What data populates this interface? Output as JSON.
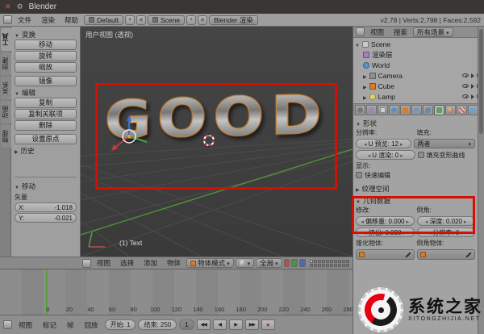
{
  "colors": {
    "annotation_red": "#d40f04",
    "selection_orange": "#e08a2e",
    "frame_line_green": "#55a03a",
    "watermark_red": "#e60012"
  },
  "window": {
    "title": "Blender"
  },
  "info_bar": {
    "menus": [
      "文件",
      "渲染",
      "帮助"
    ],
    "screen": "Default",
    "scene": "Scene",
    "engine": "Blender 渲染",
    "stats": "v2.78 | Verts:2,798 | Faces:2,592"
  },
  "tool_tabs": [
    "工具",
    "创建",
    "关系",
    "动画",
    "物理"
  ],
  "tool_shelf": {
    "transform": {
      "title": "变换",
      "buttons": [
        "移动",
        "旋转",
        "缩放"
      ],
      "mirror": "镜像"
    },
    "edit": {
      "title": "编辑",
      "buttons": [
        "复制",
        "复制关联项",
        "删除"
      ],
      "origin": "设置原点"
    },
    "history": {
      "title": "历史"
    },
    "redo": {
      "title": "移动",
      "vector_label": "矢量",
      "x_label": "X:",
      "x_value": "-1.018",
      "y_label": "Y:",
      "y_value": "-0.021"
    }
  },
  "viewport": {
    "view_label": "用户视图 (透视)",
    "object_label": "(1) Text",
    "text": "GOOD",
    "header": {
      "menus": [
        "视图",
        "选择",
        "添加",
        "物体"
      ],
      "mode": "物体模式",
      "orientation": "全局"
    }
  },
  "timeline": {
    "numbers": [
      "0",
      "20",
      "40",
      "60",
      "80",
      "100",
      "120",
      "140",
      "160",
      "180",
      "200",
      "220",
      "240",
      "260",
      "280"
    ],
    "menus": [
      "视图",
      "标记",
      "帧",
      "回放"
    ],
    "start": "开始: 1",
    "end": "结束: 250",
    "frame": "1"
  },
  "outliner": {
    "menus": [
      "视图",
      "搜索"
    ],
    "display_mode": "所有场景",
    "items": [
      {
        "label": "Scene"
      },
      {
        "label": "渲染层"
      },
      {
        "label": "World"
      },
      {
        "label": "Camera"
      },
      {
        "label": "Cube"
      },
      {
        "label": "Lamp"
      }
    ]
  },
  "properties": {
    "shape": {
      "title": "形状",
      "resolution_label": "分辨率:",
      "fill_label": "填充:",
      "preview_u": "U 预览: 12",
      "render_u": "U 渲染: 0",
      "fill_mode": "两者",
      "fill_deformed": "填充变形曲线",
      "display_label": "显示:",
      "fast_editing": "快速编辑"
    },
    "texture_space": {
      "title": "纹理空间"
    },
    "geometry": {
      "title": "几何数据",
      "modification_label": "修改:",
      "bevel_label": "倒角:",
      "offset": "偏移量: 0.000",
      "extrude": "挤出: 0.098",
      "depth": "深度: 0.020",
      "resolution": "分辨率: 0",
      "taper_label": "锥化物体:",
      "bevel_object_label": "倒角物体:"
    }
  },
  "watermark": {
    "name": "系统之家",
    "url": "XITONGZHIJIA.NET"
  }
}
